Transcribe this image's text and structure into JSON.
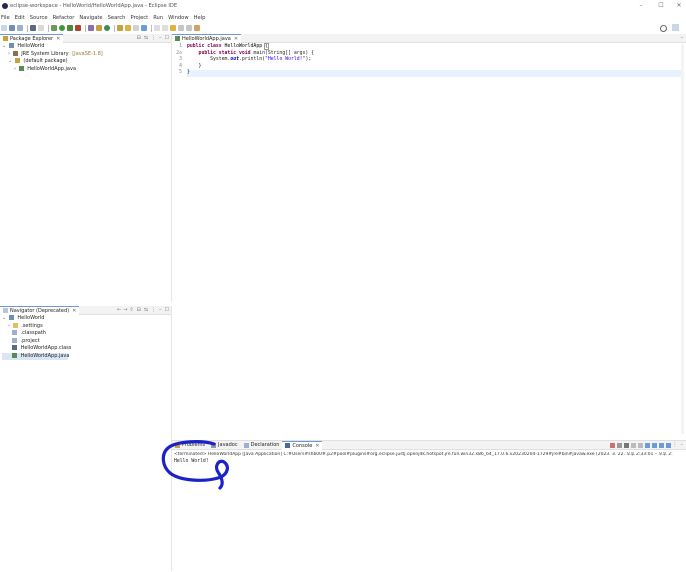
{
  "window": {
    "title": "eclipse-workspace - HelloWorld/HelloWorldApp.java - Eclipse IDE",
    "minimize": "–",
    "maximize": "☐",
    "close": "✕"
  },
  "menu": [
    "File",
    "Edit",
    "Source",
    "Refactor",
    "Navigate",
    "Search",
    "Project",
    "Run",
    "Window",
    "Help"
  ],
  "package_explorer": {
    "tab": "Package Explorer",
    "close": "✕",
    "items": [
      {
        "label": "HelloWorld",
        "indent": 0,
        "arrow": "⌄"
      },
      {
        "label": "JRE System Library",
        "suffix": "[JavaSE-1.8]",
        "indent": 1,
        "arrow": "›"
      },
      {
        "label": "(default package)",
        "indent": 1,
        "arrow": "⌄"
      },
      {
        "label": "HelloWorldApp.java",
        "indent": 2,
        "arrow": "›"
      }
    ]
  },
  "navigator": {
    "tab": "Navigator (Deprecated)",
    "close": "✕",
    "items": [
      {
        "label": "HelloWorld",
        "indent": 0,
        "arrow": "⌄"
      },
      {
        "label": ".settings",
        "indent": 1,
        "arrow": "›"
      },
      {
        "label": ".classpath",
        "indent": 1,
        "arrow": ""
      },
      {
        "label": ".project",
        "indent": 1,
        "arrow": ""
      },
      {
        "label": "HelloWorldApp.class",
        "indent": 1,
        "arrow": ""
      },
      {
        "label": "HelloWorldApp.java",
        "indent": 1,
        "arrow": "",
        "selected": true
      }
    ]
  },
  "editor": {
    "tab": "HelloWorldApp.java",
    "close": "✕",
    "line_numbers": [
      "1",
      "2⊖",
      "3",
      "4",
      "5"
    ],
    "lines": [
      {
        "kw1": "public class ",
        "name": "HelloWorldApp ",
        "rest": "{"
      },
      {
        "kw1": "    public static void ",
        "name": "main(String[] args) {",
        "rest": ""
      },
      {
        "kw1": "        System.",
        "fld": "out",
        "name": ".println(",
        "str": "\"Hello World!\"",
        "rest": ");"
      },
      {
        "kw1": "",
        "name": "    }",
        "rest": ""
      },
      {
        "kw1": "",
        "name": "}",
        "rest": ""
      }
    ]
  },
  "bottom": {
    "tabs": [
      "Problems",
      "Javadoc",
      "Declaration",
      "Console"
    ],
    "active_tab": "Console",
    "console_close": "✕",
    "header": "<terminated> HelloWorldApp [Java Application] C:#Users#shb00#.p2#pool#plugins#org.eclipse.justj.openjdk.hotspot.jre.full.win32.x86_64_17.0.6.v20230204-1729#jre#bin#javaw.exe (2023. 3. 22. 오후 2:33:01 – 오후 2:",
    "output": "Hello World!"
  },
  "colors": {
    "accent": "#6b9cd8",
    "keyword": "#7f0055",
    "string": "#2a00ff",
    "annotation_ink": "#1a22c8"
  }
}
